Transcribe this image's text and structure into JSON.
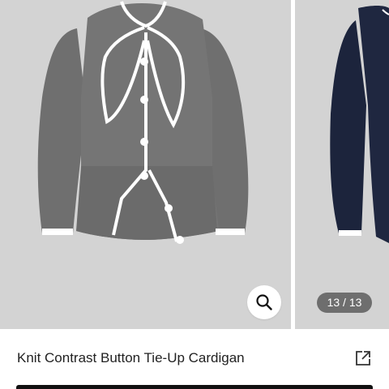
{
  "gallery": {
    "counter": "13 / 13",
    "zoom_icon": "search-icon",
    "background_color": "#d3d3d3",
    "main_item_color": "#717171",
    "next_item_color": "#1e2742",
    "trim_color": "#ffffff"
  },
  "product": {
    "title": "Knit Contrast Button Tie-Up Cardigan",
    "share_icon": "share-external-icon"
  }
}
